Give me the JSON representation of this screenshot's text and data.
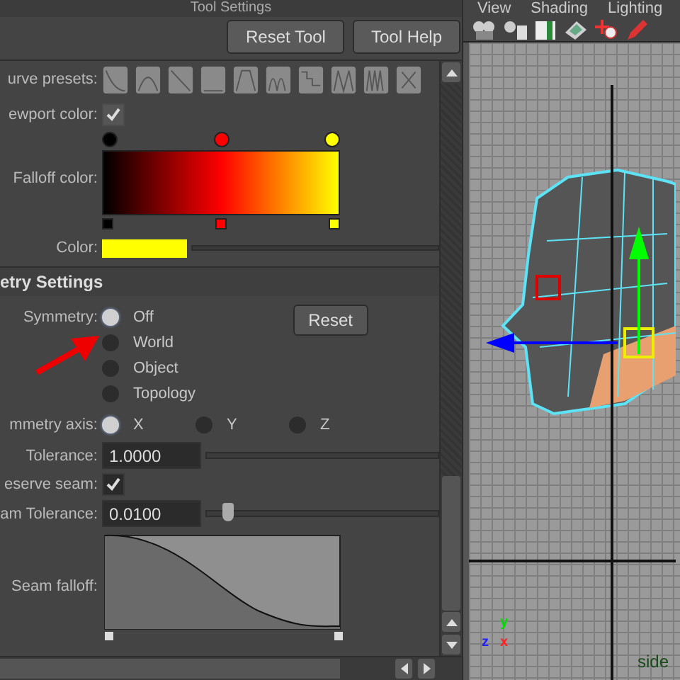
{
  "tool_settings": {
    "title": "Tool Settings",
    "buttons": [
      "Reset Tool",
      "Tool Help"
    ]
  },
  "curve_presets": {
    "label": "urve presets:"
  },
  "viewport_color": {
    "label": "ewport color:",
    "checked": true
  },
  "falloff_color": {
    "label": "Falloff color:",
    "stops": [
      {
        "color": "#000000"
      },
      {
        "color": "#ff0000"
      },
      {
        "color": "#ffff00"
      }
    ]
  },
  "color": {
    "label": "Color:",
    "color": "#ffff00"
  },
  "symmetry_settings": {
    "title": "etry Settings",
    "symmetry": {
      "label": "Symmetry:",
      "options": [
        {
          "label": "Off",
          "selected": true
        },
        {
          "label": "World",
          "selected": false
        },
        {
          "label": "Object",
          "selected": false
        },
        {
          "label": "Topology",
          "selected": false
        }
      ]
    },
    "reset": "Reset",
    "axis": {
      "label": "mmetry axis:",
      "options": [
        {
          "label": "X",
          "selected": true
        },
        {
          "label": "Y",
          "selected": false
        },
        {
          "label": "Z",
          "selected": false
        }
      ]
    },
    "tolerance": {
      "label": "Tolerance:",
      "value": "1.0000"
    },
    "preserve_seam": {
      "label": "eserve seam:",
      "checked": true
    },
    "seam_tolerance": {
      "label": "am Tolerance:",
      "value": "0.0100",
      "level": 0.07
    },
    "seam_falloff": {
      "label": "Seam falloff:"
    }
  },
  "viewport": {
    "menu": [
      "View",
      "Shading",
      "Lighting"
    ],
    "axis_labels": [
      {
        "label": "y",
        "color": "#00dd00"
      },
      {
        "label": "z",
        "color": "#2222ff"
      },
      {
        "label": "x",
        "color": "#ff2222"
      }
    ],
    "camera": "side"
  }
}
